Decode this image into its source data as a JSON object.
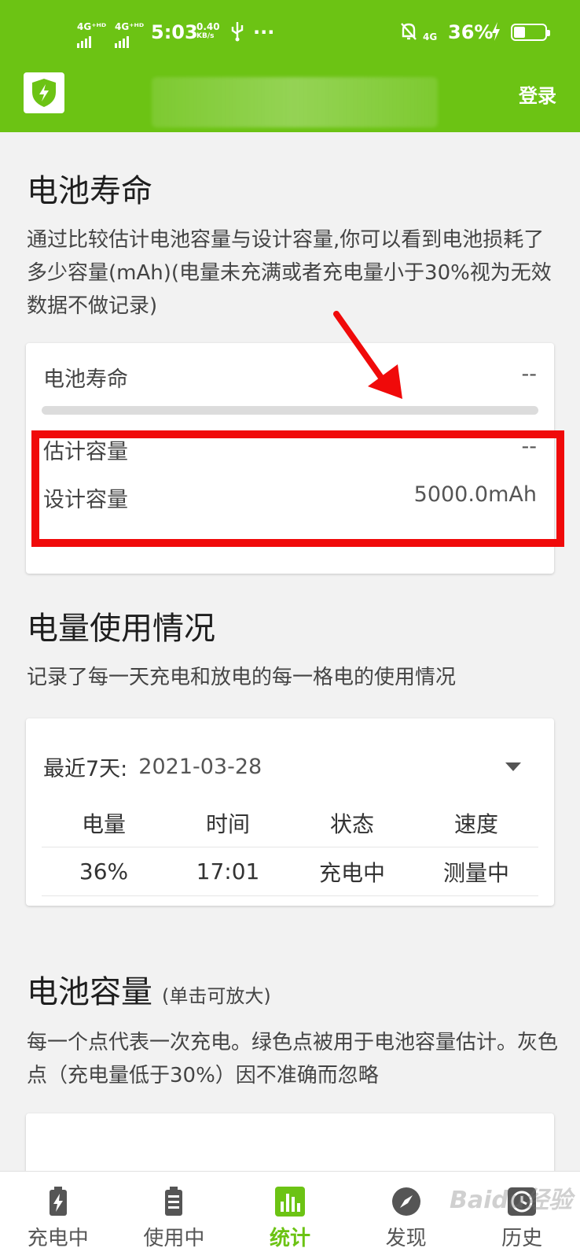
{
  "status_bar": {
    "net1": "4G⁺ᴴᴰ",
    "net2": "4G⁺ᴴᴰ",
    "time": "5:03",
    "speed_value": "0.40",
    "speed_unit": "KB/s",
    "usb_icon": "usb-icon",
    "more": "···",
    "mute_icon": "bell-off-icon",
    "net3": "4G",
    "battery": "36%",
    "battery_level": 0.36
  },
  "app_bar": {
    "logo_icon": "shield-bolt-icon",
    "login": "登录"
  },
  "battery_life": {
    "title": "电池寿命",
    "desc": "通过比较估计电池容量与设计容量,你可以看到电池损耗了多少容量(mAh)(电量未充满或者充电量小于30%视为无效数据不做记录)",
    "card": {
      "life_label": "电池寿命",
      "life_value": "--",
      "life_progress": 0,
      "est_label": "估计容量",
      "est_value": "--",
      "design_label": "设计容量",
      "design_value": "5000.0mAh"
    }
  },
  "usage": {
    "title": "电量使用情况",
    "desc": "记录了每一天充电和放电的每一格电的使用情况",
    "card": {
      "range_label": "最近7天:",
      "range_value": "2021-03-28",
      "headers": [
        "电量",
        "时间",
        "状态",
        "速度"
      ],
      "rows": [
        [
          "36%",
          "17:01",
          "充电中",
          "测量中"
        ]
      ]
    }
  },
  "capacity": {
    "title": "电池容量",
    "subtitle": "(单击可放大)",
    "desc": "每一个点代表一次充电。绿色点被用于电池容量估计。灰色点（充电量低于30%）因不准确而忽略"
  },
  "bottom_nav": {
    "items": [
      {
        "label": "充电中",
        "icon": "battery-charging-icon"
      },
      {
        "label": "使用中",
        "icon": "battery-list-icon"
      },
      {
        "label": "统计",
        "icon": "bar-chart-icon"
      },
      {
        "label": "发现",
        "icon": "compass-icon"
      },
      {
        "label": "历史",
        "icon": "clock-icon"
      }
    ],
    "active": "统计"
  },
  "watermark": "Baidu经验",
  "colors": {
    "accent": "#6cc314",
    "highlight": "#f00a0a"
  }
}
